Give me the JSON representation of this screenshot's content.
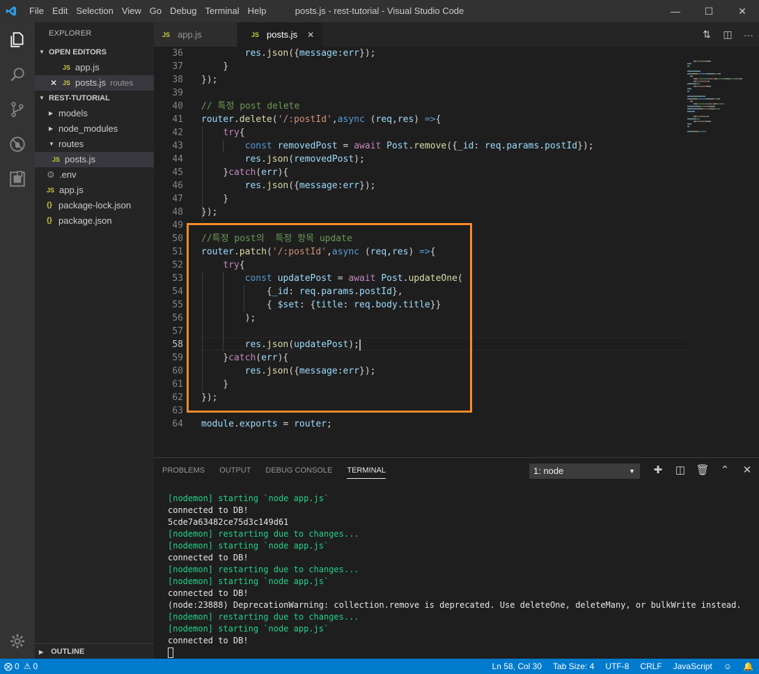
{
  "titlebar": {
    "menu": [
      "File",
      "Edit",
      "Selection",
      "View",
      "Go",
      "Debug",
      "Terminal",
      "Help"
    ],
    "title": "posts.js - rest-tutorial - Visual Studio Code"
  },
  "sidebar": {
    "title": "EXPLORER",
    "open_editors_label": "OPEN EDITORS",
    "open_editors": [
      {
        "icon": "JS",
        "name": "app.js",
        "hint": ""
      },
      {
        "icon": "JS",
        "name": "posts.js",
        "hint": "routes"
      }
    ],
    "project_label": "REST-TUTORIAL",
    "folders": [
      "models",
      "node_modules",
      "routes"
    ],
    "routes_child": "posts.js",
    "files": [
      {
        "icon": "gear",
        "name": ".env"
      },
      {
        "icon": "JS",
        "name": "app.js"
      },
      {
        "icon": "{}",
        "name": "package-lock.json"
      },
      {
        "icon": "{}",
        "name": "package.json"
      }
    ],
    "outline_label": "OUTLINE"
  },
  "tabs": [
    {
      "icon": "JS",
      "label": "app.js"
    },
    {
      "icon": "JS",
      "label": "posts.js"
    }
  ],
  "editor": {
    "lines": [
      {
        "n": "36",
        "t": [
          [
            "p",
            "        "
          ],
          [
            "v",
            "res"
          ],
          [
            "p",
            "."
          ],
          [
            "f",
            "json"
          ],
          [
            "p",
            "({"
          ],
          [
            "v",
            "message"
          ],
          [
            "p",
            ":"
          ],
          [
            "v",
            "err"
          ],
          [
            "p",
            "});"
          ]
        ]
      },
      {
        "n": "37",
        "t": [
          [
            "p",
            "    }"
          ]
        ]
      },
      {
        "n": "38",
        "t": [
          [
            "p",
            "});"
          ]
        ]
      },
      {
        "n": "39",
        "t": []
      },
      {
        "n": "40",
        "t": [
          [
            "c",
            "// 특정 post delete"
          ]
        ]
      },
      {
        "n": "41",
        "t": [
          [
            "v",
            "router"
          ],
          [
            "p",
            "."
          ],
          [
            "f",
            "delete"
          ],
          [
            "p",
            "("
          ],
          [
            "s",
            "'/:postId'"
          ],
          [
            "p",
            ","
          ],
          [
            "k",
            "async"
          ],
          [
            "p",
            " ("
          ],
          [
            "v",
            "req"
          ],
          [
            "p",
            ","
          ],
          [
            "v",
            "res"
          ],
          [
            "p",
            ") "
          ],
          [
            "k",
            "=>"
          ],
          [
            "p",
            "{"
          ]
        ]
      },
      {
        "n": "42",
        "t": [
          [
            "p",
            "    "
          ],
          [
            "x",
            "try"
          ],
          [
            "p",
            "{"
          ]
        ]
      },
      {
        "n": "43",
        "t": [
          [
            "p",
            "        "
          ],
          [
            "k",
            "const"
          ],
          [
            "p",
            " "
          ],
          [
            "v",
            "removedPost"
          ],
          [
            "p",
            " = "
          ],
          [
            "x",
            "await"
          ],
          [
            "p",
            " "
          ],
          [
            "v",
            "Post"
          ],
          [
            "p",
            "."
          ],
          [
            "f",
            "remove"
          ],
          [
            "p",
            "({"
          ],
          [
            "v",
            "_id"
          ],
          [
            "p",
            ": "
          ],
          [
            "v",
            "req"
          ],
          [
            "p",
            "."
          ],
          [
            "v",
            "params"
          ],
          [
            "p",
            "."
          ],
          [
            "v",
            "postId"
          ],
          [
            "p",
            "});"
          ]
        ]
      },
      {
        "n": "44",
        "t": [
          [
            "p",
            "        "
          ],
          [
            "v",
            "res"
          ],
          [
            "p",
            "."
          ],
          [
            "f",
            "json"
          ],
          [
            "p",
            "("
          ],
          [
            "v",
            "removedPost"
          ],
          [
            "p",
            ");"
          ]
        ]
      },
      {
        "n": "45",
        "t": [
          [
            "p",
            "    }"
          ],
          [
            "x",
            "catch"
          ],
          [
            "p",
            "("
          ],
          [
            "v",
            "err"
          ],
          [
            "p",
            "){"
          ]
        ]
      },
      {
        "n": "46",
        "t": [
          [
            "p",
            "        "
          ],
          [
            "v",
            "res"
          ],
          [
            "p",
            "."
          ],
          [
            "f",
            "json"
          ],
          [
            "p",
            "({"
          ],
          [
            "v",
            "message"
          ],
          [
            "p",
            ":"
          ],
          [
            "v",
            "err"
          ],
          [
            "p",
            "});"
          ]
        ]
      },
      {
        "n": "47",
        "t": [
          [
            "p",
            "    }"
          ]
        ]
      },
      {
        "n": "48",
        "t": [
          [
            "p",
            "});"
          ]
        ]
      },
      {
        "n": "49",
        "t": []
      },
      {
        "n": "50",
        "t": [
          [
            "c",
            "//특정 post의  특정 항목 update"
          ]
        ]
      },
      {
        "n": "51",
        "t": [
          [
            "v",
            "router"
          ],
          [
            "p",
            "."
          ],
          [
            "f",
            "patch"
          ],
          [
            "p",
            "("
          ],
          [
            "s",
            "'/:postId'"
          ],
          [
            "p",
            ","
          ],
          [
            "k",
            "async"
          ],
          [
            "p",
            " ("
          ],
          [
            "v",
            "req"
          ],
          [
            "p",
            ","
          ],
          [
            "v",
            "res"
          ],
          [
            "p",
            ") "
          ],
          [
            "k",
            "=>"
          ],
          [
            "p",
            "{"
          ]
        ]
      },
      {
        "n": "52",
        "t": [
          [
            "p",
            "    "
          ],
          [
            "x",
            "try"
          ],
          [
            "p",
            "{"
          ]
        ]
      },
      {
        "n": "53",
        "t": [
          [
            "p",
            "        "
          ],
          [
            "k",
            "const"
          ],
          [
            "p",
            " "
          ],
          [
            "v",
            "updatePost"
          ],
          [
            "p",
            " = "
          ],
          [
            "x",
            "await"
          ],
          [
            "p",
            " "
          ],
          [
            "v",
            "Post"
          ],
          [
            "p",
            "."
          ],
          [
            "f",
            "updateOne"
          ],
          [
            "p",
            "("
          ]
        ]
      },
      {
        "n": "54",
        "t": [
          [
            "p",
            "            {"
          ],
          [
            "v",
            "_id"
          ],
          [
            "p",
            ": "
          ],
          [
            "v",
            "req"
          ],
          [
            "p",
            "."
          ],
          [
            "v",
            "params"
          ],
          [
            "p",
            "."
          ],
          [
            "v",
            "postId"
          ],
          [
            "p",
            "},"
          ]
        ]
      },
      {
        "n": "55",
        "t": [
          [
            "p",
            "            { "
          ],
          [
            "v",
            "$set"
          ],
          [
            "p",
            ": {"
          ],
          [
            "v",
            "title"
          ],
          [
            "p",
            ": "
          ],
          [
            "v",
            "req"
          ],
          [
            "p",
            "."
          ],
          [
            "v",
            "body"
          ],
          [
            "p",
            "."
          ],
          [
            "v",
            "title"
          ],
          [
            "p",
            "}}"
          ]
        ]
      },
      {
        "n": "56",
        "t": [
          [
            "p",
            "        );"
          ]
        ]
      },
      {
        "n": "57",
        "t": []
      },
      {
        "n": "58",
        "t": [
          [
            "p",
            "        "
          ],
          [
            "v",
            "res"
          ],
          [
            "p",
            "."
          ],
          [
            "f",
            "json"
          ],
          [
            "p",
            "("
          ],
          [
            "v",
            "updatePost"
          ],
          [
            "p",
            ");"
          ]
        ]
      },
      {
        "n": "59",
        "t": [
          [
            "p",
            "    }"
          ],
          [
            "x",
            "catch"
          ],
          [
            "p",
            "("
          ],
          [
            "v",
            "err"
          ],
          [
            "p",
            "){"
          ]
        ]
      },
      {
        "n": "60",
        "t": [
          [
            "p",
            "        "
          ],
          [
            "v",
            "res"
          ],
          [
            "p",
            "."
          ],
          [
            "f",
            "json"
          ],
          [
            "p",
            "({"
          ],
          [
            "v",
            "message"
          ],
          [
            "p",
            ":"
          ],
          [
            "v",
            "err"
          ],
          [
            "p",
            "});"
          ]
        ]
      },
      {
        "n": "61",
        "t": [
          [
            "p",
            "    }"
          ]
        ]
      },
      {
        "n": "62",
        "t": [
          [
            "p",
            "});"
          ]
        ]
      },
      {
        "n": "63",
        "t": []
      },
      {
        "n": "64",
        "t": [
          [
            "v",
            "module"
          ],
          [
            "p",
            "."
          ],
          [
            "v",
            "exports"
          ],
          [
            "p",
            " = "
          ],
          [
            "v",
            "router"
          ],
          [
            "p",
            ";"
          ]
        ]
      }
    ],
    "current_line": "58"
  },
  "panel": {
    "tabs": [
      "PROBLEMS",
      "OUTPUT",
      "DEBUG CONSOLE",
      "TERMINAL"
    ],
    "active_tab": "TERMINAL",
    "terminal_select": "1: node",
    "terminal_lines": [
      {
        "c": "g",
        "t": "[nodemon] starting `node app.js`"
      },
      {
        "c": "w",
        "t": "connected to DB!"
      },
      {
        "c": "w",
        "t": "5cde7a63482ce75d3c149d61"
      },
      {
        "c": "g",
        "t": "[nodemon] restarting due to changes..."
      },
      {
        "c": "g",
        "t": "[nodemon] starting `node app.js`"
      },
      {
        "c": "w",
        "t": "connected to DB!"
      },
      {
        "c": "g",
        "t": "[nodemon] restarting due to changes..."
      },
      {
        "c": "g",
        "t": "[nodemon] starting `node app.js`"
      },
      {
        "c": "w",
        "t": "connected to DB!"
      },
      {
        "c": "w",
        "t": "(node:23888) DeprecationWarning: collection.remove is deprecated. Use deleteOne, deleteMany, or bulkWrite instead."
      },
      {
        "c": "g",
        "t": "[nodemon] restarting due to changes..."
      },
      {
        "c": "g",
        "t": "[nodemon] starting `node app.js`"
      },
      {
        "c": "w",
        "t": "connected to DB!"
      }
    ]
  },
  "statusbar": {
    "errors": "0",
    "warnings": "0",
    "position": "Ln 58, Col 30",
    "tab_size": "Tab Size: 4",
    "encoding": "UTF-8",
    "eol": "CRLF",
    "language": "JavaScript"
  },
  "colors": {
    "accent": "#007acc",
    "highlight_box": "#f98b2a"
  }
}
